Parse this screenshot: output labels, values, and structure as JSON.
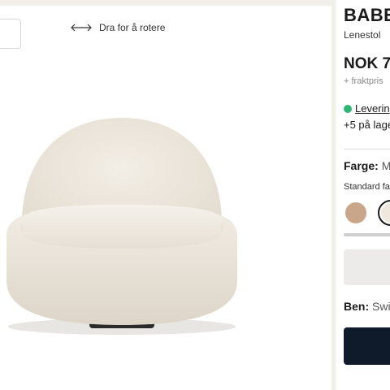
{
  "viewer": {
    "rotate_hint": "Dra for å rotere",
    "icons": {
      "rotate": "horizontal-arrows-icon"
    }
  },
  "product": {
    "title": "BABE",
    "subtitle": "Lenestol",
    "price": "NOK 7",
    "freight": "+ fraktpris",
    "stock_status": "Levering",
    "stock_extra": "+5 på lage",
    "color_label": "Farge:",
    "color_value": "M",
    "standard_label": "Standard fa",
    "leg_label": "Ben:",
    "leg_value": "Swi"
  },
  "colors": {
    "background": "#f2efea",
    "in_stock": "#2cb673",
    "cta": "#0f1b2b",
    "swatch_1": "#c9a68a",
    "swatch_2": "#efe9dd"
  }
}
